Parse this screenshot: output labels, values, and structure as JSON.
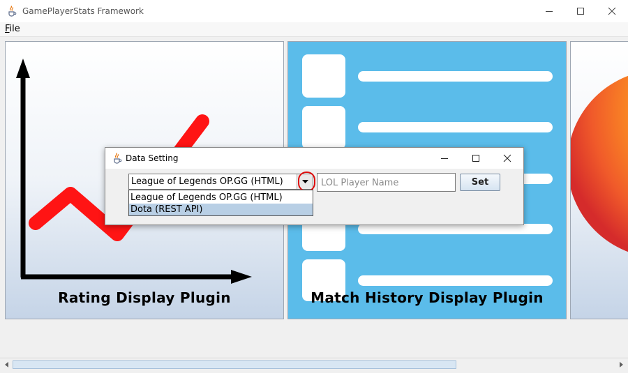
{
  "window": {
    "title": "GamePlayerStats Framework",
    "icon": "java-coffee-icon",
    "controls": [
      "minimize-icon",
      "maximize-icon",
      "close-icon"
    ]
  },
  "menu": {
    "items": [
      {
        "label": "File",
        "mnemonic": "F",
        "rest": "ile"
      }
    ]
  },
  "panels": [
    {
      "label": "Rating Display Plugin",
      "icon": "rating-chart-icon"
    },
    {
      "label": "Match History Display Plugin",
      "icon": "match-history-list-icon"
    },
    {
      "label": "",
      "icon": "orange-sphere-icon"
    }
  ],
  "dialog": {
    "title": "Data Setting",
    "icon": "java-coffee-icon",
    "data_source": {
      "selected": "League of Legends OP.GG (HTML)",
      "options": [
        "League of Legends OP.GG (HTML)",
        "Dota (REST API)"
      ],
      "highlighted_index": 1,
      "expanded": true
    },
    "player_name": {
      "value": "",
      "placeholder": "LOL Player Name"
    },
    "set_label": "Set"
  },
  "annotation": {
    "shape": "red-circle",
    "color": "#e01010"
  },
  "colors": {
    "match_panel_bg": "#5bbcea",
    "chart_line": "#ff0000",
    "dropdown_highlight": "#b8cfe5"
  }
}
